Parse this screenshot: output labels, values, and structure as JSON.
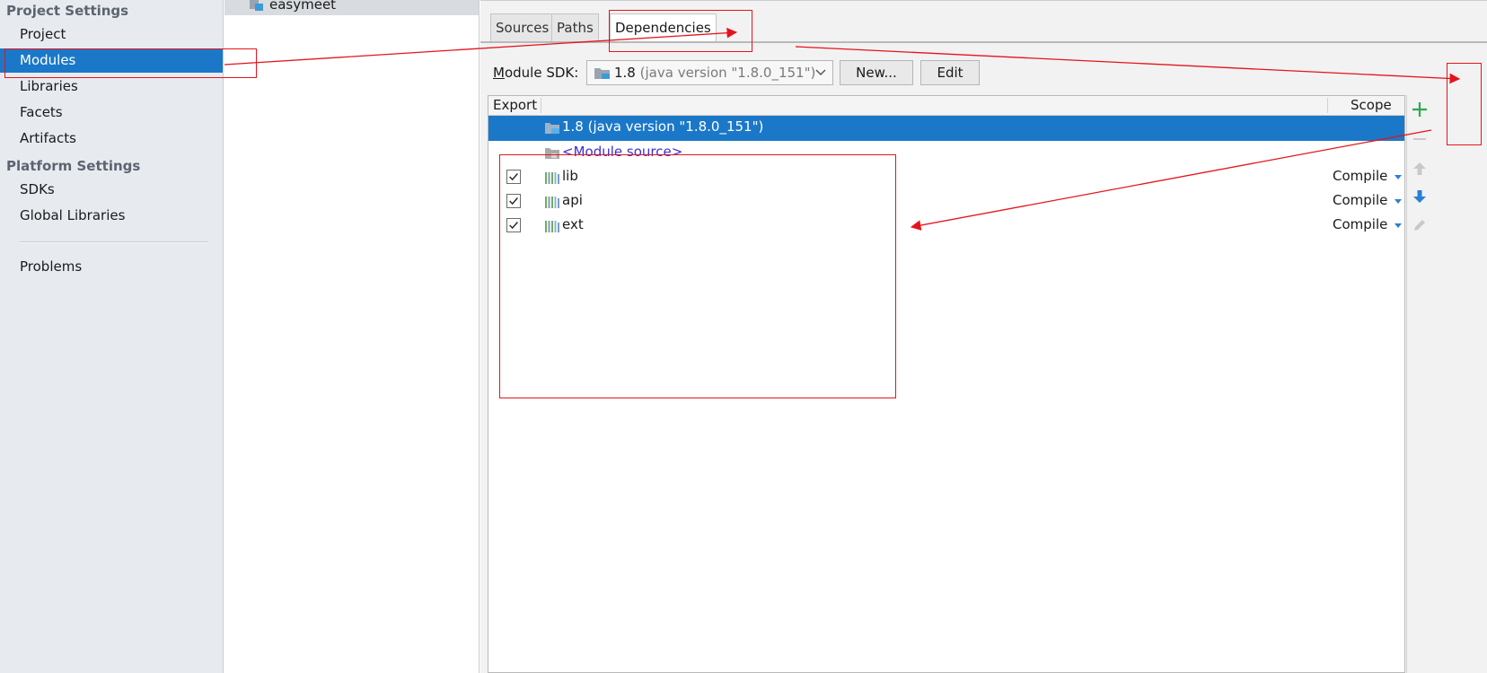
{
  "sidebar": {
    "project_settings_header": "Project Settings",
    "platform_settings_header": "Platform Settings",
    "items": [
      {
        "label": "Project"
      },
      {
        "label": "Modules"
      },
      {
        "label": "Libraries"
      },
      {
        "label": "Facets"
      },
      {
        "label": "Artifacts"
      },
      {
        "label": "SDKs"
      },
      {
        "label": "Global Libraries"
      },
      {
        "label": "Problems"
      }
    ],
    "selected": "Modules"
  },
  "tree": {
    "module_name": "easymeet"
  },
  "tabs": [
    {
      "label": "Sources"
    },
    {
      "label": "Paths"
    },
    {
      "label": "Dependencies"
    }
  ],
  "active_tab": "Dependencies",
  "sdk": {
    "label_prefix": "M",
    "label_rest": "odule SDK:",
    "selected_name": "1.8",
    "selected_version": "(java version \"1.8.0_151\")",
    "new_button": "New...",
    "edit_button": "Edit"
  },
  "table": {
    "headers": {
      "export": "Export",
      "scope": "Scope"
    },
    "rows": [
      {
        "name": "1.8 (java version \"1.8.0_151\")",
        "kind": "sdk",
        "selected": true
      },
      {
        "name": "<Module source>",
        "kind": "source",
        "selected": false
      },
      {
        "name": "lib",
        "kind": "library",
        "checked": true,
        "scope": "Compile"
      },
      {
        "name": "api",
        "kind": "library",
        "checked": true,
        "scope": "Compile"
      },
      {
        "name": "ext",
        "kind": "library",
        "checked": true,
        "scope": "Compile"
      }
    ]
  },
  "colors": {
    "selection": "#1b78c8",
    "annotation": "#e5141b",
    "add": "#2fa84f",
    "move_down": "#2a7fd4"
  },
  "icons": [
    "module-icon",
    "sdk-folder-icon",
    "chevron-down-icon",
    "source-folder-icon",
    "library-icon",
    "add-icon",
    "remove-icon",
    "move-up-icon",
    "move-down-icon",
    "edit-icon"
  ]
}
